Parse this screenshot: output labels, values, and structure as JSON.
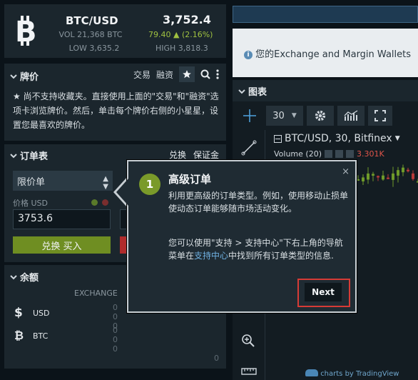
{
  "ticker": {
    "pair": "BTC/USD",
    "price": "3,752.4",
    "volume": "VOL 21,368 BTC",
    "change": "79.40 ▲ (2.16%)",
    "low": "LOW 3,635.2",
    "high": "HIGH 3,818.3"
  },
  "pairs_panel": {
    "title": "牌价",
    "tabs": [
      "交易",
      "融资"
    ],
    "message": "★ 尚不支持收藏夹。直接使用上面的\"交易\"和\"融资\"选项卡浏览牌价。然后，单击每个牌价右侧的小星星，设置您最喜欢的牌价。"
  },
  "order_form": {
    "title": "订单表",
    "tabs": [
      "兑换",
      "保证金"
    ],
    "order_type": "限价单",
    "price_label": "价格 USD",
    "price_value": "3753.6",
    "buy_button": "兑换 买入"
  },
  "balances": {
    "title": "余额",
    "column_header": "EXCHANGE",
    "rows": [
      {
        "currency": "USD",
        "values": [
          "0",
          "0",
          "0"
        ]
      },
      {
        "currency": "BTC",
        "values": [
          "0",
          "0",
          "0"
        ]
      }
    ],
    "total": "0"
  },
  "wallet_notice": "您的Exchange and Margin Wallets",
  "chart": {
    "title": "图表",
    "interval": "30",
    "symbol": "BTC/USD, 30, Bitfinex",
    "volume_label": "Volume (20)",
    "volume_value": "3.301K",
    "attribution": "charts by TradingView"
  },
  "tour": {
    "step": "1",
    "title": "高级订单",
    "body1": "利用更高级的订单类型。例如，使用移动止损单使动态订单能够随市场活动变化。",
    "body2_prefix": "您可以使用\"支持 > 支持中心\"下右上角的导航菜单在",
    "body2_link": "支持中心",
    "body2_suffix": "中找到所有订单类型的信息.",
    "close": "×",
    "next_button": "Next"
  },
  "colors": {
    "buy_green": "#6f8e22",
    "step_green": "#7a9a2a",
    "highlight_red": "#d63b36",
    "link_blue": "#6fb0e0"
  }
}
